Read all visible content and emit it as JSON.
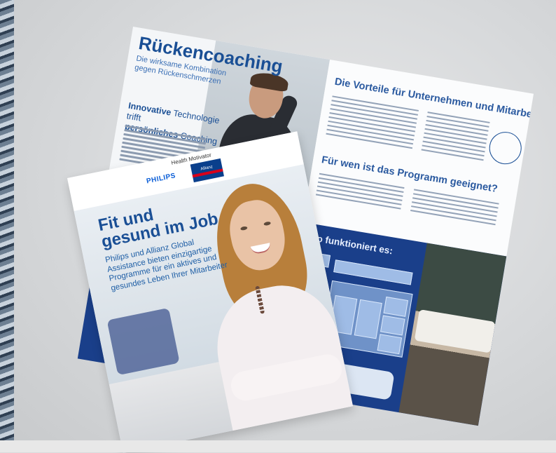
{
  "back_brochure": {
    "title": "Rückencoaching",
    "subtitle": "Die wirksame Kombination gegen Rückenschmerzen",
    "heading_strong": "Innovative",
    "heading_rest": " Technologie trifft",
    "heading_line2_strong": "persönliches",
    "heading_line2_rest": " Coaching",
    "right_title_pre": "Die ",
    "right_title_strong": "Vorteile",
    "right_title_post": " für Unternehmen und Mitarbeiter",
    "right_title2_strong": "Für wen",
    "right_title2_rest": " ist das Programm geeignet?",
    "bottom_title": "So funktioniert es:"
  },
  "front_brochure": {
    "brand_label": "Health Motivator",
    "philips": "PHILIPS",
    "allianz": "Allianz",
    "title": "Fit und gesund im Job",
    "subtitle": "Philips und Allianz Global Assistance bieten einzigartige Programme für ein aktives und gesundes Leben Ihrer Mitarbeiter"
  },
  "colors": {
    "brand_blue": "#1a4f95",
    "dark_blue_panel": "#1a3f8a",
    "allianz_red": "#d8001a"
  }
}
